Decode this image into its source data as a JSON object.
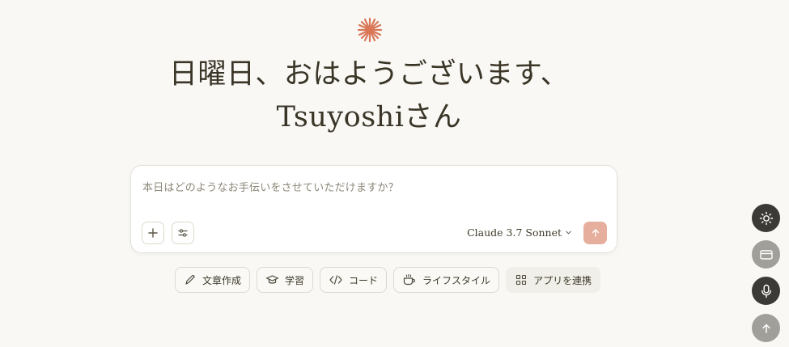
{
  "greeting": {
    "line1": "日曜日、おはようございます、",
    "line2": "Tsuyoshiさん"
  },
  "composer": {
    "placeholder": "本日はどのようなお手伝いをさせていただけますか？",
    "model": "Claude 3.7 Sonnet"
  },
  "chips": [
    {
      "label": "文章作成",
      "icon": "pencil-icon"
    },
    {
      "label": "学習",
      "icon": "graduation-cap-icon"
    },
    {
      "label": "コード",
      "icon": "code-icon"
    },
    {
      "label": "ライフスタイル",
      "icon": "coffee-cup-icon"
    },
    {
      "label": "アプリを連携",
      "icon": "grid-icon"
    }
  ],
  "side_buttons": [
    {
      "icon": "sun-icon"
    },
    {
      "icon": "window-icon"
    },
    {
      "icon": "microphone-icon"
    },
    {
      "icon": "arrow-up-icon"
    }
  ],
  "colors": {
    "background": "#f9f8f5",
    "accent": "#d97757",
    "send_button": "#e6ae9c"
  }
}
